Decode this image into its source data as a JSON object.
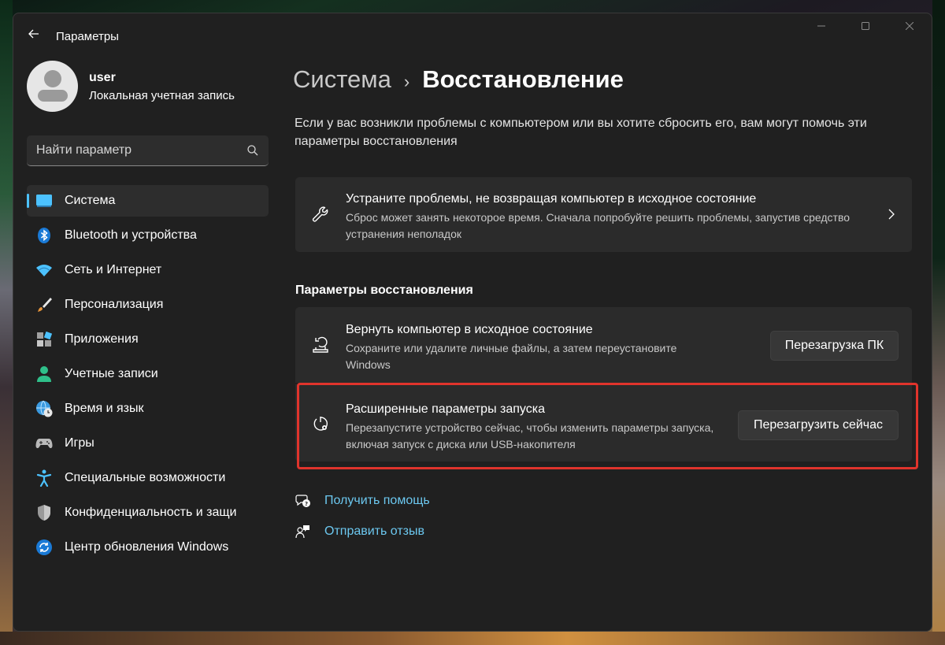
{
  "window": {
    "title": "Параметры",
    "controls": [
      "minimize-icon",
      "maximize-icon",
      "close-icon"
    ]
  },
  "profile": {
    "name": "user",
    "account_type": "Локальная учетная запись"
  },
  "search": {
    "placeholder": "Найти параметр"
  },
  "sidebar": {
    "items": [
      {
        "label": "Система",
        "icon": "system-icon",
        "active": true
      },
      {
        "label": "Bluetooth и устройства",
        "icon": "bluetooth-icon"
      },
      {
        "label": "Сеть и Интернет",
        "icon": "wifi-icon"
      },
      {
        "label": "Персонализация",
        "icon": "brush-icon"
      },
      {
        "label": "Приложения",
        "icon": "apps-icon"
      },
      {
        "label": "Учетные записи",
        "icon": "account-icon"
      },
      {
        "label": "Время и язык",
        "icon": "globe-clock-icon"
      },
      {
        "label": "Игры",
        "icon": "gamepad-icon"
      },
      {
        "label": "Специальные возможности",
        "icon": "accessibility-icon"
      },
      {
        "label": "Конфиденциальность и защи",
        "icon": "shield-icon"
      },
      {
        "label": "Центр обновления Windows",
        "icon": "update-icon"
      }
    ]
  },
  "main": {
    "breadcrumb_parent": "Система",
    "breadcrumb_separator": "›",
    "breadcrumb_current": "Восстановление",
    "intro": "Если у вас возникли проблемы с компьютером или вы хотите сбросить его, вам могут помочь эти параметры восстановления",
    "troubleshoot_card": {
      "title": "Устраните проблемы, не возвращая компьютер в исходное состояние",
      "description": "Сброс может занять некоторое время. Сначала попробуйте решить проблемы, запустив средство устранения неполадок",
      "icon": "wrench-icon"
    },
    "section_title": "Параметры восстановления",
    "reset_card": {
      "title": "Вернуть компьютер в исходное состояние",
      "description": "Сохраните или удалите личные файлы, а затем переустановите Windows",
      "button": "Перезагрузка ПК",
      "icon": "reset-pc-icon"
    },
    "advanced_card": {
      "title": "Расширенные параметры запуска",
      "description": "Перезапустите устройство сейчас, чтобы изменить параметры запуска, включая запуск с диска или USB-накопителя",
      "button": "Перезагрузить сейчас",
      "icon": "advanced-startup-icon"
    },
    "links": [
      {
        "label": "Получить помощь",
        "icon": "help-icon"
      },
      {
        "label": "Отправить отзыв",
        "icon": "feedback-icon"
      }
    ]
  },
  "colors": {
    "accent": "#4cc2ff",
    "link": "#6cc8f0",
    "highlight": "#e0342c",
    "window_bg": "#202020",
    "card_bg": "#2b2b2b"
  }
}
